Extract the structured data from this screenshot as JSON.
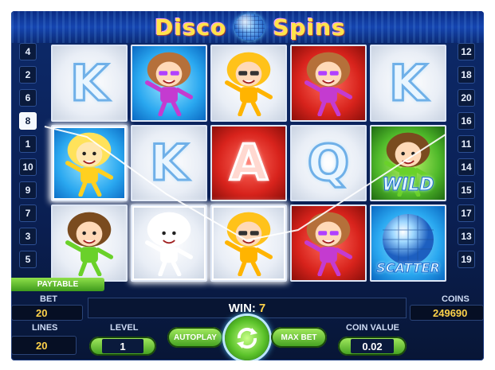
{
  "logo": {
    "word1": "Disco",
    "word2": "Spins"
  },
  "left_lines": [
    "4",
    "2",
    "6",
    "8",
    "1",
    "10",
    "9",
    "7",
    "3",
    "5"
  ],
  "right_lines": [
    "12",
    "18",
    "20",
    "16",
    "11",
    "14",
    "15",
    "17",
    "13",
    "19"
  ],
  "active_left_line": "8",
  "reels": [
    [
      {
        "symbol": "K",
        "bg": "light",
        "kind": "letter"
      },
      {
        "symbol": "blonde-girl",
        "bg": "blue",
        "kind": "char",
        "win": true
      },
      {
        "symbol": "green-dancer",
        "bg": "light",
        "kind": "char"
      }
    ],
    [
      {
        "symbol": "pink-dancer",
        "bg": "blue",
        "kind": "char"
      },
      {
        "symbol": "K",
        "bg": "light",
        "kind": "letter"
      },
      {
        "symbol": "white-blonde-girl",
        "bg": "light",
        "kind": "char",
        "win": true
      }
    ],
    [
      {
        "symbol": "yellow-dancer",
        "bg": "light",
        "kind": "char"
      },
      {
        "symbol": "A",
        "bg": "red",
        "kind": "letter"
      },
      {
        "symbol": "yellow-dancer",
        "bg": "light",
        "kind": "char",
        "win": true
      }
    ],
    [
      {
        "symbol": "pink-dancer",
        "bg": "red",
        "kind": "char"
      },
      {
        "symbol": "Q",
        "bg": "light",
        "kind": "letter"
      },
      {
        "symbol": "pink-dancer",
        "bg": "red",
        "kind": "char"
      }
    ],
    [
      {
        "symbol": "K",
        "bg": "light",
        "kind": "letter"
      },
      {
        "symbol": "WILD",
        "bg": "green",
        "kind": "wild"
      },
      {
        "symbol": "SCATTER",
        "bg": "blue",
        "kind": "scatter"
      }
    ]
  ],
  "paytable_label": "PAYTABLE",
  "bet": {
    "label": "BET",
    "value": "20"
  },
  "lines": {
    "label": "LINES",
    "value": "20"
  },
  "level": {
    "label": "LEVEL",
    "value": "1"
  },
  "win": {
    "label": "WIN:",
    "value": "7"
  },
  "coins": {
    "label": "COINS",
    "value": "249690"
  },
  "coin_value": {
    "label": "COIN VALUE",
    "value": "0.02"
  },
  "autoplay_label": "AUTOPLAY",
  "maxbet_label": "MAX BET",
  "colors": {
    "accent_green": "#5bc22a",
    "gold": "#ffd34a",
    "navy": "#0a1f52"
  }
}
